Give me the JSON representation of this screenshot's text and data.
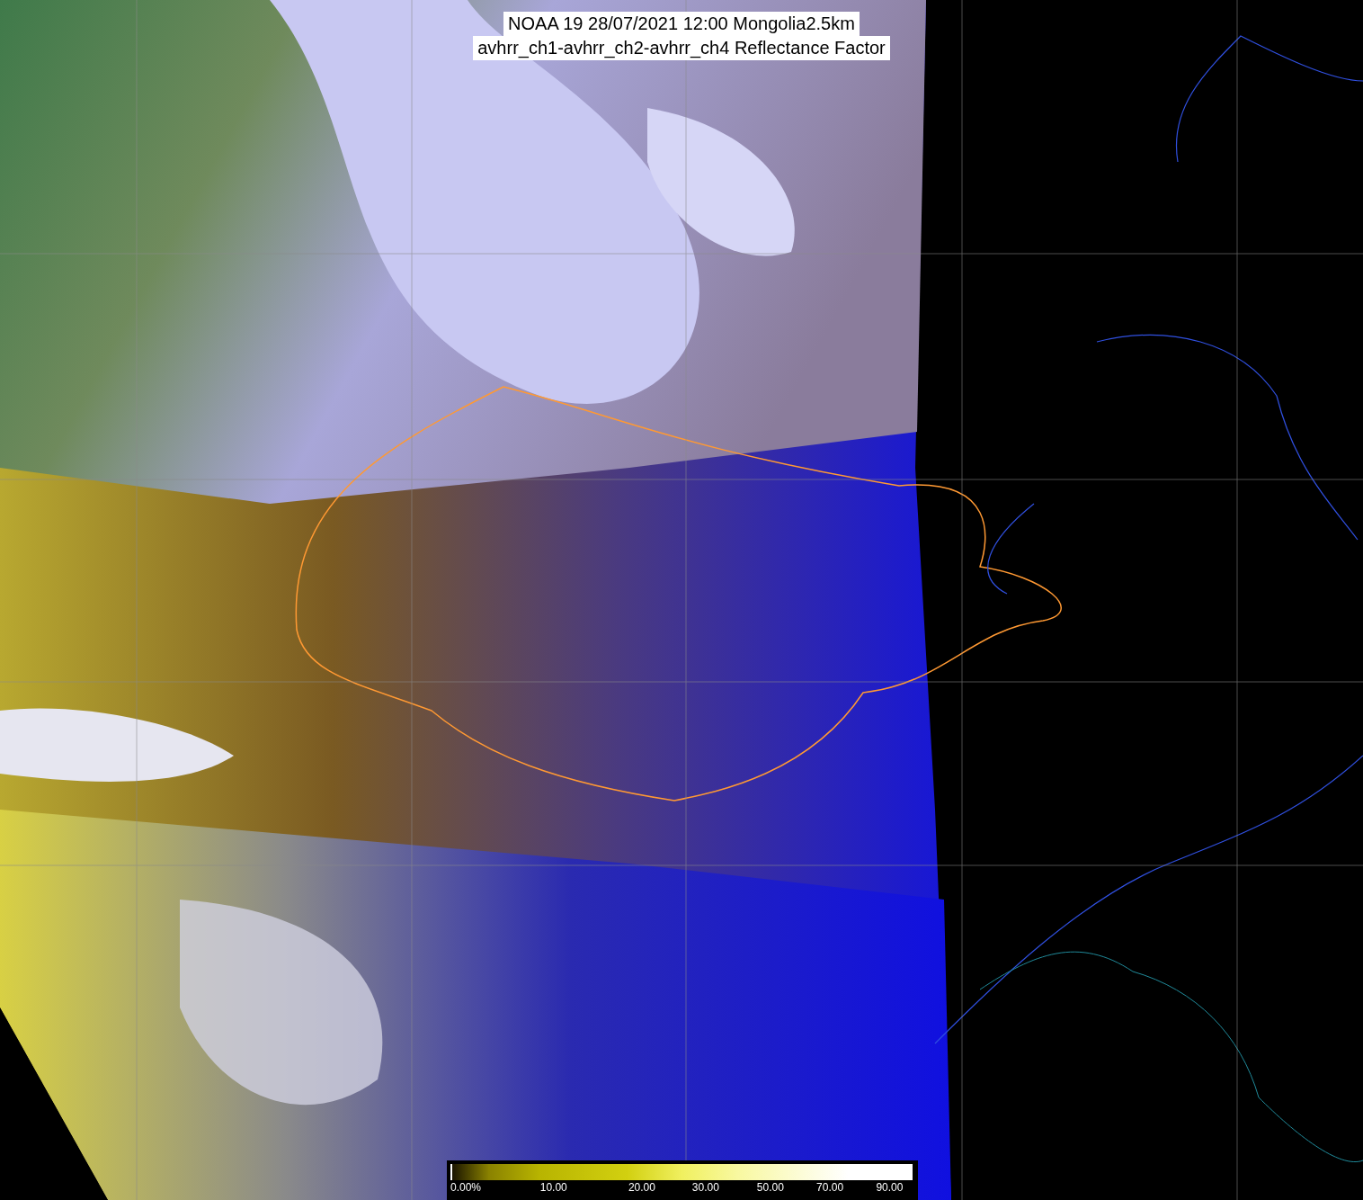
{
  "title": {
    "lines": [
      "NOAA 19 28/07/2021 12:00 Mongolia2.5km",
      "avhrr_ch1-avhrr_ch2-avhrr_ch4 Reflectance Factor"
    ]
  },
  "colorbar": {
    "labels": [
      "0.00%",
      "10.00",
      "20.00",
      "30.00",
      "50.00",
      "70.00",
      "90.00"
    ]
  }
}
